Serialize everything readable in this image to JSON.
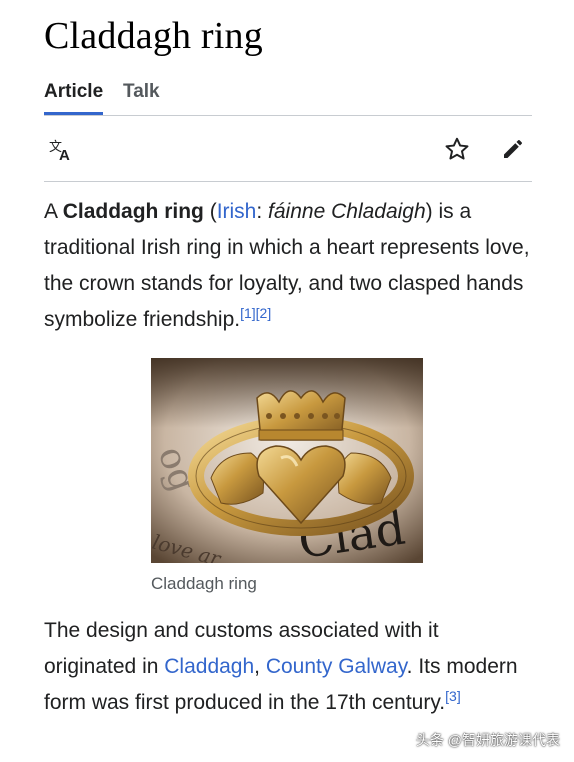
{
  "page_title": "Claddagh ring",
  "tabs": [
    {
      "label": "Article",
      "active": true
    },
    {
      "label": "Talk",
      "active": false
    }
  ],
  "toolbar": {
    "language_icon": "translate-icon",
    "watch_icon": "star-icon",
    "edit_icon": "pencil-icon"
  },
  "lead": {
    "p1": "A ",
    "bold_title": "Claddagh ring",
    "p2": " (",
    "lang_link": "Irish",
    "p3": ": ",
    "irish_name": "fáinne Chladaigh",
    "p4": ") is a traditional Irish ring in which a heart represents love, the crown stands for loyalty, and two clasped hands symbolize friendship.",
    "ref1": "[1]",
    "ref2": "[2]"
  },
  "figure": {
    "caption": "Claddagh ring",
    "image_text_1": "Clad",
    "image_text_2": "love ar",
    "image_text_3": "og"
  },
  "para2": {
    "p1": "The design and customs associated with it originated in ",
    "link1": "Claddagh",
    "p2": ", ",
    "link2": "County Galway",
    "p3": ". Its modern form was first produced in the 17th century.",
    "ref3": "[3]"
  },
  "watermark": "头条 @智妍旅游课代表",
  "colors": {
    "link": "#3366cc",
    "text": "#202122",
    "accent": "#36c"
  }
}
